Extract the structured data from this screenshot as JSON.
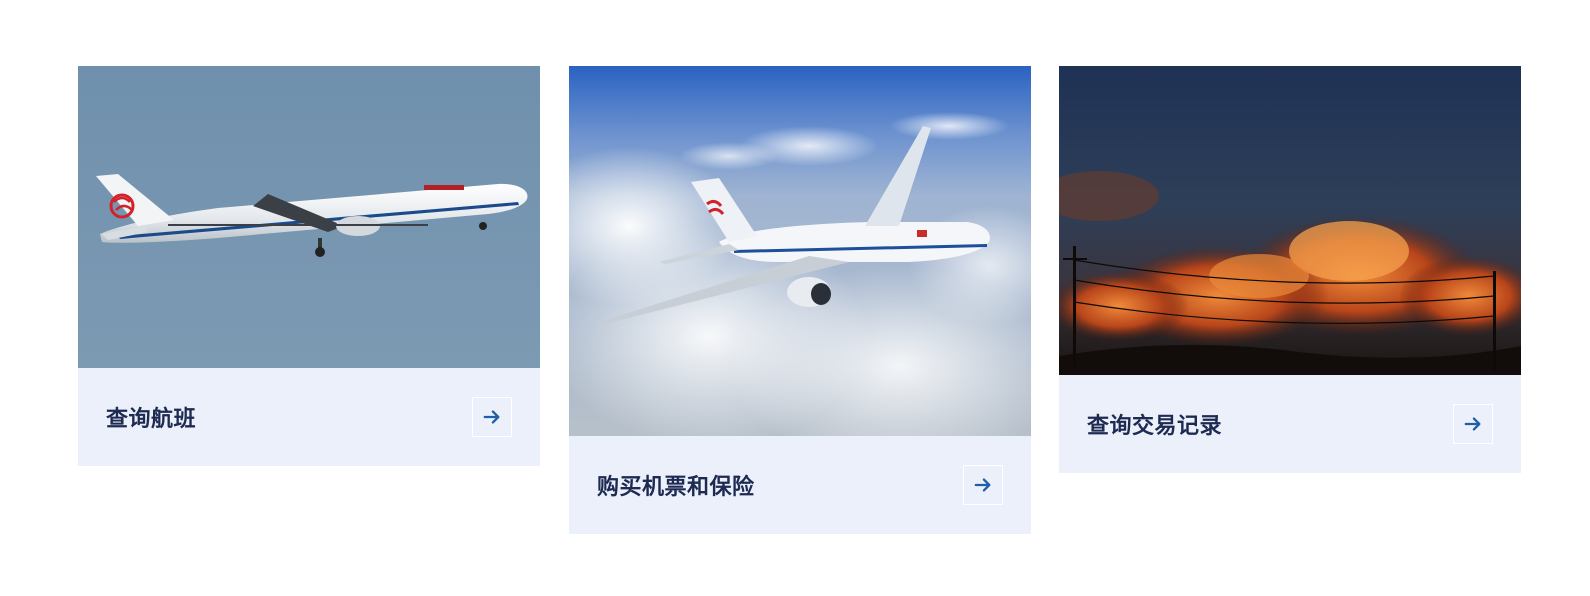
{
  "cards": [
    {
      "label": "查询航班",
      "image_alt": "Air China A321 in flight",
      "arrow_icon": "arrow-right-icon"
    },
    {
      "label": "购买机票和保险",
      "image_alt": "Air China Boeing 777 above clouds",
      "arrow_icon": "arrow-right-icon"
    },
    {
      "label": "查询交易记录",
      "image_alt": "Sunset clouds with power lines",
      "arrow_icon": "arrow-right-icon"
    }
  ],
  "colors": {
    "card_bg": "#ebf0fa",
    "label": "#1d2a52",
    "arrow": "#1f5fa8"
  }
}
